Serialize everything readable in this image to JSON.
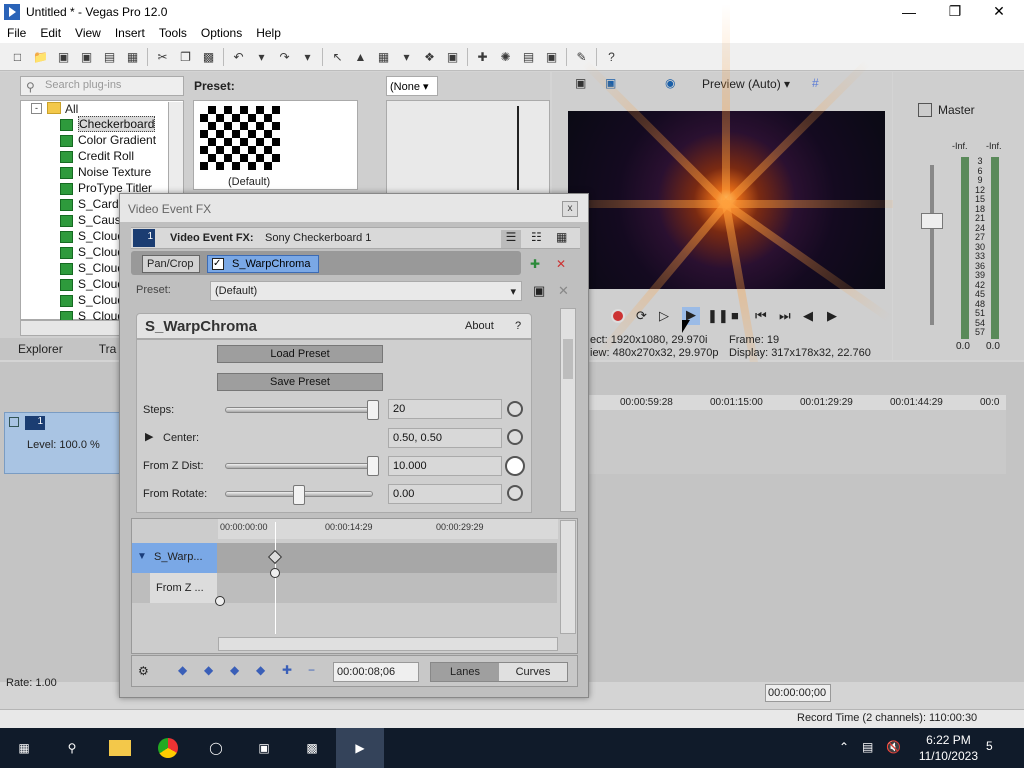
{
  "window": {
    "title": "Untitled * - Vegas Pro 12.0"
  },
  "menu": [
    "File",
    "Edit",
    "View",
    "Insert",
    "Tools",
    "Options",
    "Help"
  ],
  "explorer": {
    "search_placeholder": "Search plug-ins",
    "preset_label": "Preset:",
    "preset_default": "(Default)",
    "tree_root": "All",
    "items": [
      "Checkerboard",
      "Color Gradient",
      "Credit Roll",
      "Noise Texture",
      "ProType Titler",
      "S_Cardi",
      "S_Caust",
      "S_Cloud",
      "S_Cloud",
      "S_Cloud",
      "S_Cloud",
      "S_Cloud",
      "S_Cloud"
    ],
    "tabs": [
      "Explorer",
      "Tra"
    ]
  },
  "transitions": {
    "none_select": "(None"
  },
  "preview": {
    "mode": "Preview (Auto)",
    "project_label": "ect:",
    "project_value": "1920x1080, 29.970i",
    "frame_label": "Frame:",
    "frame_value": "19",
    "preview_label": "iew:",
    "preview_value": "480x270x32, 29.970p",
    "display_label": "Display:",
    "display_value": "317x178x32, 22.760"
  },
  "master": {
    "label": "Master",
    "inf_left": "-Inf.",
    "inf_right": "-Inf.",
    "scale": [
      "3",
      "6",
      "9",
      "12",
      "15",
      "18",
      "21",
      "24",
      "27",
      "30",
      "33",
      "36",
      "39",
      "42",
      "45",
      "48",
      "51",
      "54",
      "57"
    ],
    "bottom_left": "0.0",
    "bottom_right": "0.0"
  },
  "timeline": {
    "ticks": [
      "00:00:59:28",
      "00:01:15:00",
      "00:01:29:29",
      "00:01:44:29",
      "00:0"
    ],
    "track_level": "Level: 100.0 %",
    "track_number": "1",
    "rate": "Rate: 1.00",
    "cursor_time": "00:00:00;00",
    "record_time": "Record Time (2 channels): 110:00:30"
  },
  "fx": {
    "dialog_title": "Video Event FX",
    "close": "x",
    "header_label": "Video Event FX:",
    "header_value": "Sony Checkerboard 1",
    "track_index": "1",
    "chain": [
      "Pan/Crop",
      "S_WarpChroma"
    ],
    "preset_label": "Preset:",
    "preset_value": "(Default)",
    "plugin_name": "S_WarpChroma",
    "about": "About",
    "help": "?",
    "load_preset": "Load Preset",
    "save_preset": "Save Preset",
    "params": [
      {
        "label": "Steps:",
        "value": "20",
        "level": 1.0
      },
      {
        "label": "Center:",
        "value": "0.50, 0.50"
      },
      {
        "label": "From Z Dist:",
        "value": "10.000",
        "level": 1.0
      },
      {
        "label": "From Rotate:",
        "value": "0.00",
        "level": 0.5
      }
    ],
    "kf_ruler": [
      "00:00:00:00",
      "00:00:14:29",
      "00:00:29:29"
    ],
    "kf_track1": "S_Warp...",
    "kf_track2": "From Z ...",
    "kf_time": "00:00:08;06",
    "kf_tabs": [
      "Lanes",
      "Curves"
    ]
  },
  "taskbar": {
    "time": "6:22 PM",
    "date": "11/10/2023",
    "notif": "5"
  }
}
